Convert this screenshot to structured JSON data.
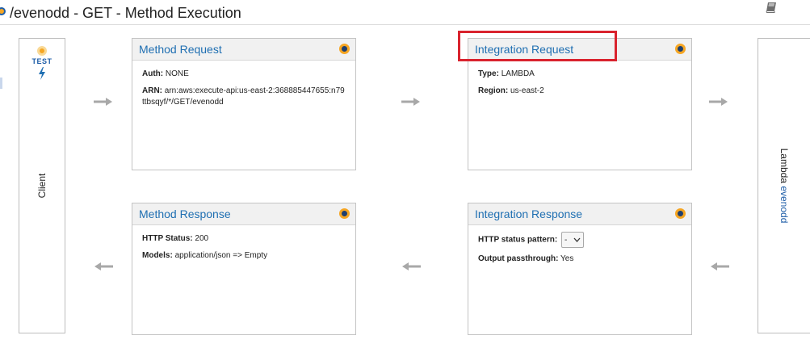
{
  "header": {
    "title": "/evenodd - GET - Method Execution"
  },
  "client": {
    "test_label": "TEST",
    "label": "Client"
  },
  "lambda": {
    "prefix": "Lambda ",
    "function_name": "evenodd"
  },
  "method_request": {
    "title": "Method Request",
    "auth_label": "Auth:",
    "auth_value": "NONE",
    "arn_label": "ARN:",
    "arn_value": "arn:aws:execute-api:us-east-2:368885447655:n79ttbsqyf/*/GET/evenodd"
  },
  "integration_request": {
    "title": "Integration Request",
    "type_label": "Type:",
    "type_value": "LAMBDA",
    "region_label": "Region:",
    "region_value": "us-east-2"
  },
  "method_response": {
    "title": "Method Response",
    "status_label": "HTTP Status:",
    "status_value": "200",
    "models_label": "Models:",
    "models_value": "application/json => Empty"
  },
  "integration_response": {
    "title": "Integration Response",
    "pattern_label": "HTTP status pattern:",
    "pattern_value": "-",
    "passthrough_label": "Output passthrough:",
    "passthrough_value": "Yes"
  },
  "colors": {
    "link": "#1f6fb2",
    "accent_orange": "#f6a623",
    "highlight_red": "#d9232e",
    "arrow_gray": "#a8a8a8"
  },
  "icons": {
    "book": "book-icon",
    "bolt": "lightning-bolt-icon",
    "status_dot": "status-dot-icon",
    "arrow_right": "arrow-right-icon",
    "arrow_left": "arrow-left-icon",
    "chevron": "chevron-down-icon"
  }
}
